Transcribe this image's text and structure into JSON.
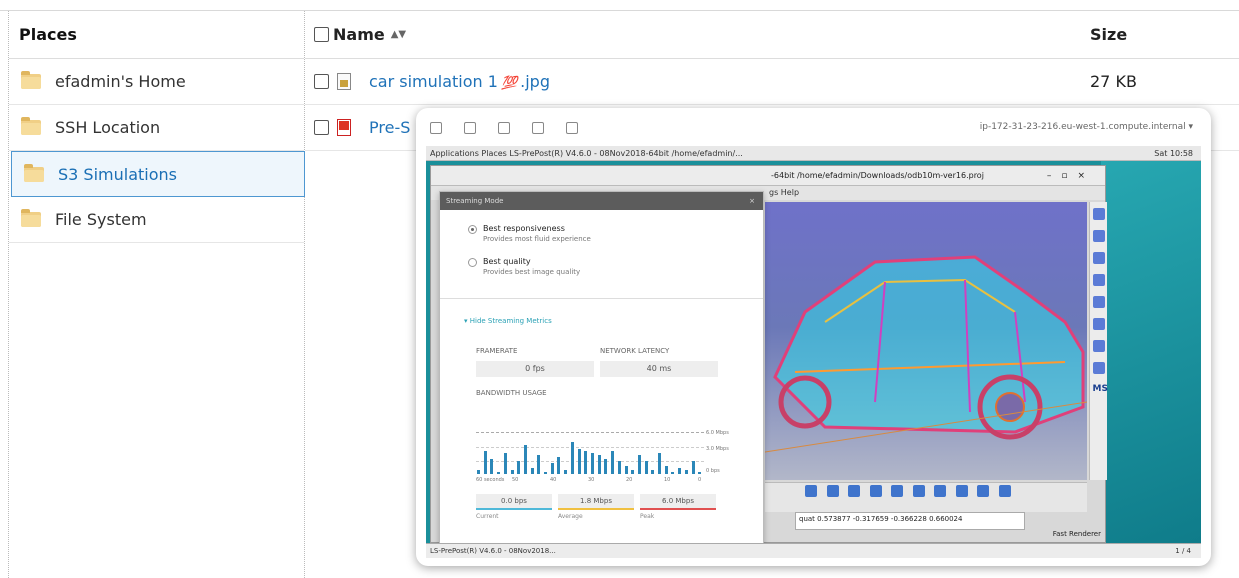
{
  "places": {
    "header": "Places",
    "items": [
      {
        "label": "efadmin's Home",
        "selected": false
      },
      {
        "label": "SSH Location",
        "selected": false
      },
      {
        "label": "S3 Simulations",
        "selected": true
      },
      {
        "label": "File System",
        "selected": false
      }
    ]
  },
  "files": {
    "name_header": "Name",
    "sort_glyph": "▲▼",
    "size_header": "Size",
    "rows": [
      {
        "name_prefix": "car simulation 1",
        "emoji": "💯",
        "name_suffix": ".jpg",
        "size": "27 KB",
        "icon": "image-file-icon"
      },
      {
        "name_prefix": "Pre-S",
        "emoji": "",
        "name_suffix": "",
        "size": "",
        "icon": "pdf-file-icon"
      }
    ]
  },
  "preview": {
    "hostname": "ip-172-31-23-216.eu-west-1.compute.internal ▾",
    "desktop_bar": {
      "left": "Applications   Places   LS-PrePost(R) V4.6.0 - 08Nov2018-64bit /home/efadmin/...",
      "clock": "Sat 10:58"
    },
    "ls_window": {
      "title": "-64bit /home/efadmin/Downloads/odb10m-ver16.proj",
      "menu": "gs   Help",
      "console_line1": "quat 0.573877 -0.317659 -0.366228 0.660024",
      "renderer": "Fast Renderer",
      "ms_label": "MS"
    },
    "taskbar": {
      "item": "LS-PrePost(R) V4.6.0 - 08Nov2018...",
      "page": "1 / 4"
    },
    "streaming": {
      "title": "Streaming Mode",
      "options": [
        {
          "label": "Best responsiveness",
          "sub": "Provides most fluid experience",
          "checked": true
        },
        {
          "label": "Best quality",
          "sub": "Provides best image quality",
          "checked": false
        }
      ],
      "toggle": "Hide Streaming Metrics",
      "framerate_label": "FRAMERATE",
      "framerate_value": "0 fps",
      "latency_label": "NETWORK LATENCY",
      "latency_value": "40 ms",
      "bandwidth_label": "BANDWIDTH USAGE",
      "bw_legend": [
        "6.0 Mbps",
        "3.0 Mbps",
        "0 bps"
      ],
      "bw_axis": [
        "60 seconds",
        "50",
        "40",
        "30",
        "20",
        "10",
        "0"
      ],
      "bw_samples": [
        0.1,
        0.55,
        0.35,
        0.05,
        0.5,
        0.1,
        0.3,
        0.7,
        0.15,
        0.45,
        0.05,
        0.25,
        0.4,
        0.1,
        0.75,
        0.6,
        0.55,
        0.5,
        0.45,
        0.35,
        0.55,
        0.3,
        0.2,
        0.1,
        0.45,
        0.3,
        0.1,
        0.5,
        0.2,
        0.05,
        0.15,
        0.1,
        0.3,
        0.05
      ],
      "rates": [
        {
          "value": "0.0 bps",
          "caption": "Current",
          "color": "#4fb9d9"
        },
        {
          "value": "1.8 Mbps",
          "caption": "Average",
          "color": "#f0c040"
        },
        {
          "value": "6.0 Mbps",
          "caption": "Peak",
          "color": "#e05050"
        }
      ]
    }
  }
}
